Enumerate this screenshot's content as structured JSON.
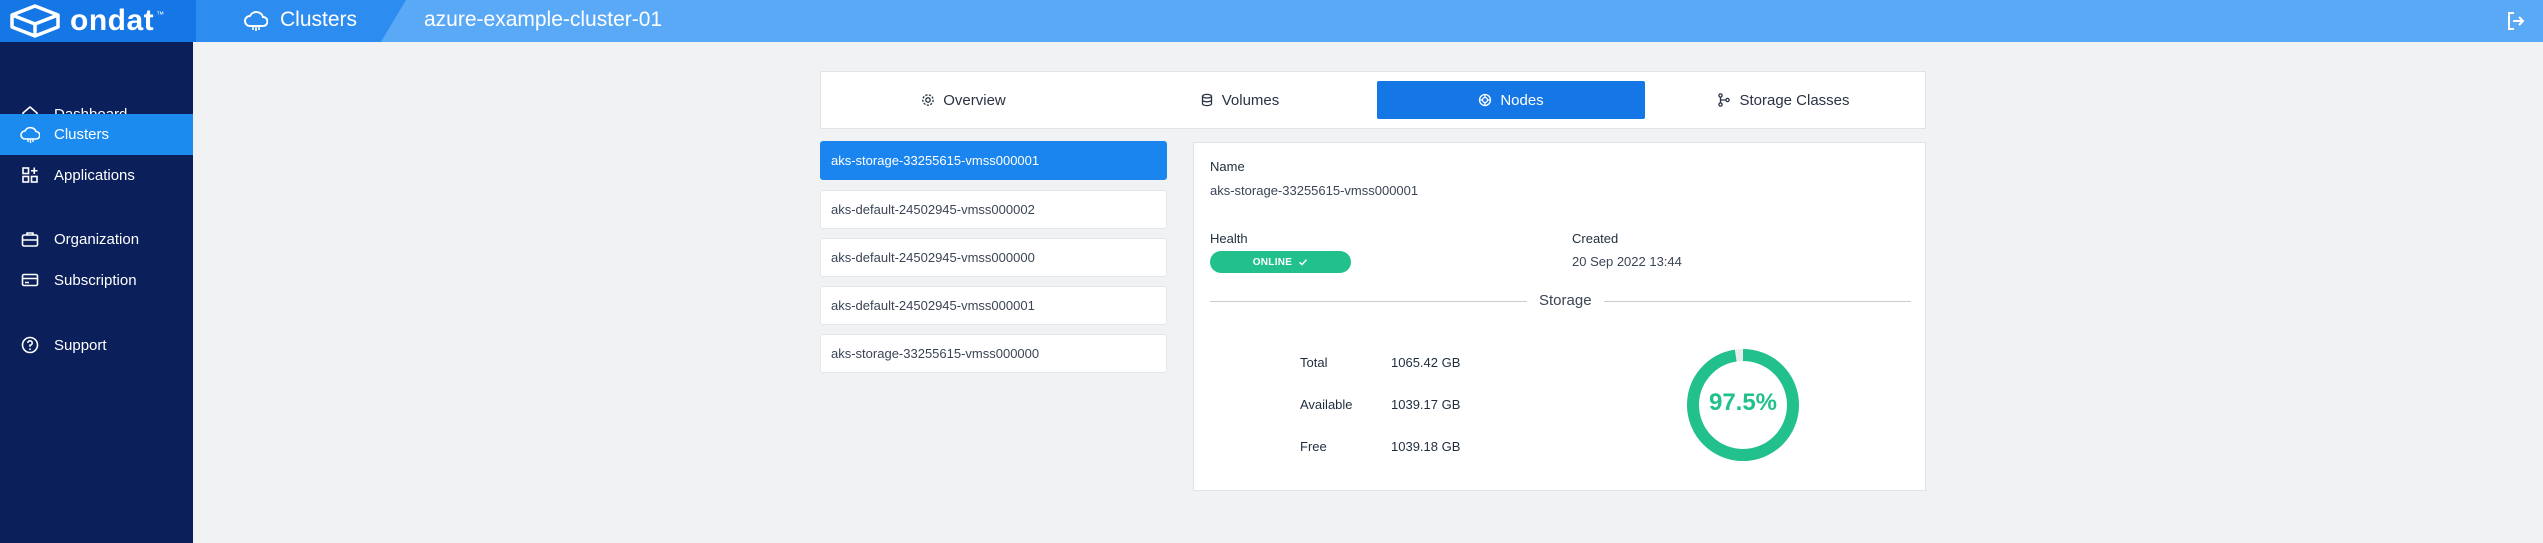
{
  "brand": {
    "name": "ondat",
    "tm": "™"
  },
  "header": {
    "section_label": "Clusters",
    "cluster_name": "azure-example-cluster-01"
  },
  "sidebar": {
    "items": [
      {
        "label": "Dashboard",
        "icon": "home-icon"
      },
      {
        "label": "Clusters",
        "icon": "cloud-icon",
        "active": true
      },
      {
        "label": "Applications",
        "icon": "apps-icon"
      },
      {
        "label": "Organization",
        "icon": "briefcase-icon"
      },
      {
        "label": "Subscription",
        "icon": "credit-card-icon"
      },
      {
        "label": "Support",
        "icon": "help-circle-icon"
      }
    ]
  },
  "tabs": [
    {
      "label": "Overview",
      "icon": "settings-icon"
    },
    {
      "label": "Volumes",
      "icon": "database-icon"
    },
    {
      "label": "Nodes",
      "icon": "node-icon",
      "active": true
    },
    {
      "label": "Storage Classes",
      "icon": "share-icon"
    }
  ],
  "nodes": [
    "aks-storage-33255615-vmss000001",
    "aks-default-24502945-vmss000002",
    "aks-default-24502945-vmss000000",
    "aks-default-24502945-vmss000001",
    "aks-storage-33255615-vmss000000"
  ],
  "detail": {
    "name_label": "Name",
    "name_value": "aks-storage-33255615-vmss000001",
    "health_label": "Health",
    "health_value": "ONLINE",
    "created_label": "Created",
    "created_value": "20 Sep 2022 13:44",
    "storage_title": "Storage",
    "stats": [
      {
        "label": "Total",
        "value": "1065.42 GB"
      },
      {
        "label": "Available",
        "value": "1039.17 GB"
      },
      {
        "label": "Free",
        "value": "1039.18 GB"
      }
    ],
    "usage_percent_label": "97.5%",
    "usage_fraction": 0.975
  },
  "colors": {
    "accent": "#1577e6",
    "sidebar": "#0b1f5a",
    "topbar": "#59a9f7",
    "success": "#22c08c"
  }
}
